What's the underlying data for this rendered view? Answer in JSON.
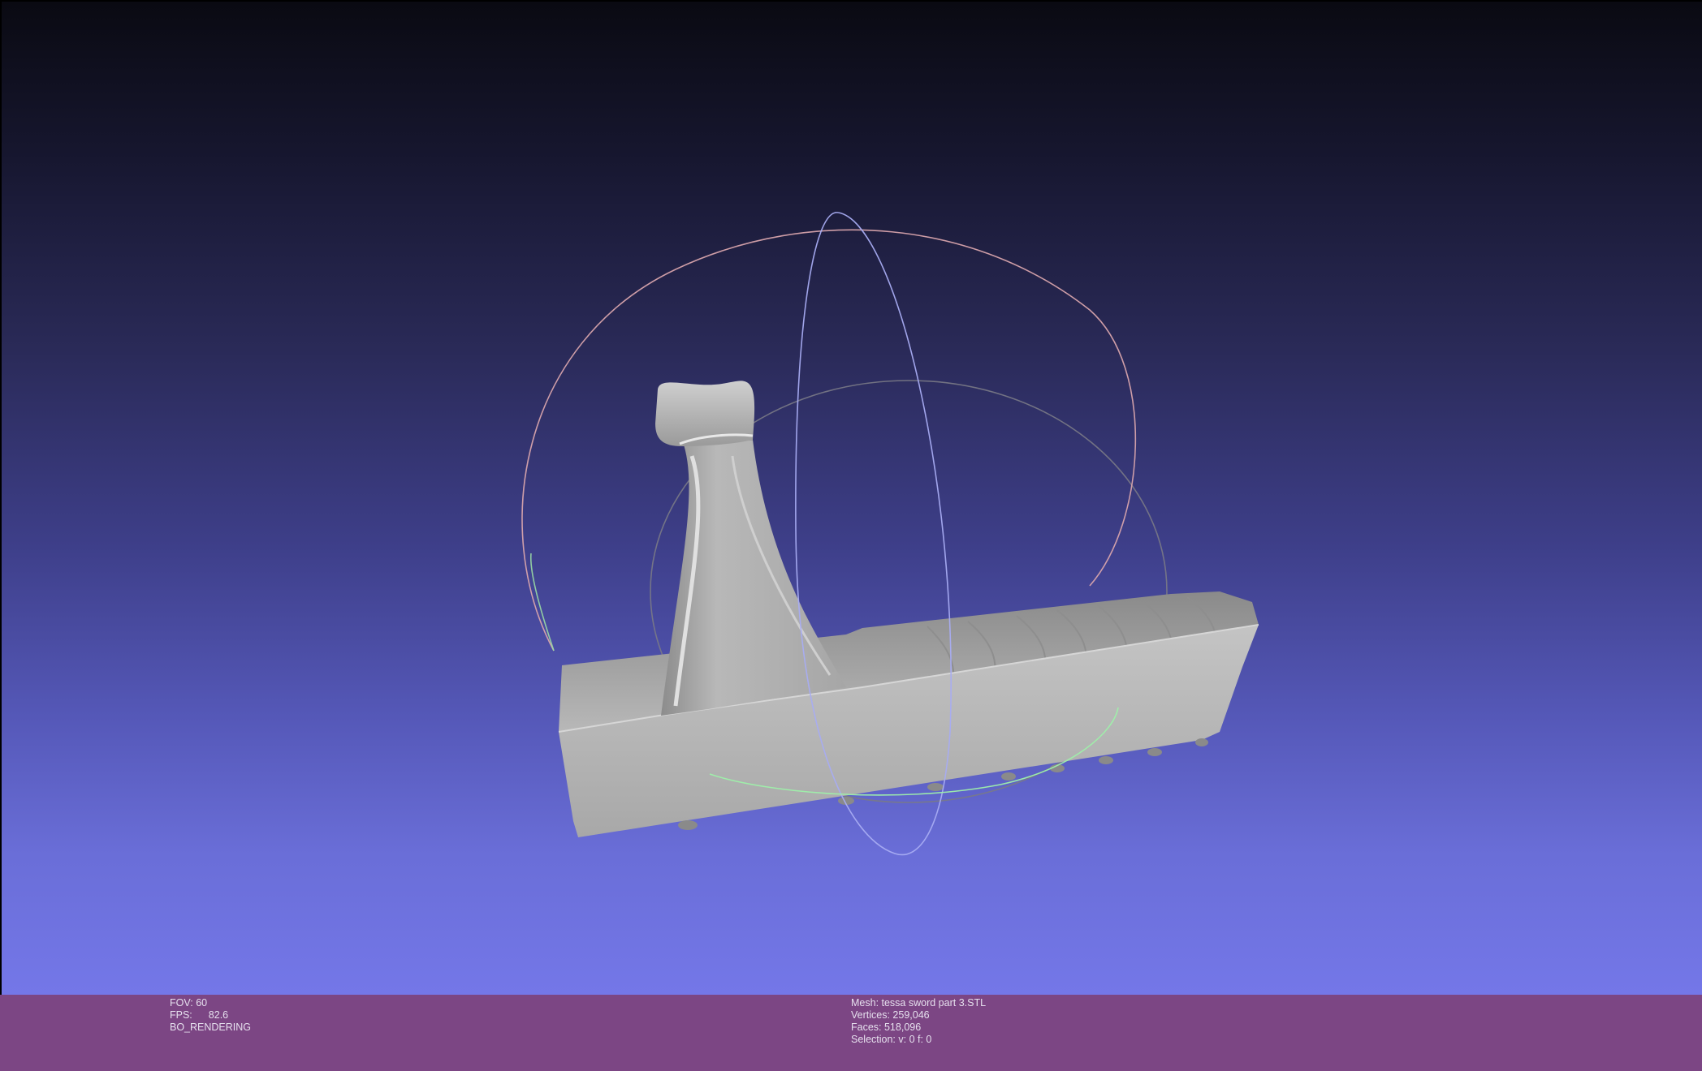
{
  "viewport": {
    "name": "3d-viewport",
    "background_top": "#0a0a12",
    "background_bottom": "#7477e8"
  },
  "trackball": {
    "x_ring_color": "#e0a0a8",
    "y_ring_color": "#a0a8f0",
    "z_ring_color": "#90f0a0"
  },
  "model": {
    "color": "#b4b4b4"
  },
  "info_left": {
    "fov_label": "FOV:",
    "fov_value": "60",
    "fps_label": "FPS:",
    "fps_value": "82.6",
    "mode": "BO_RENDERING"
  },
  "info_right": {
    "mesh": "Mesh: tessa sword part 3.STL",
    "vertices": "Vertices: 259,046",
    "faces": "Faces: 518,096",
    "selection": "Selection: v: 0 f: 0"
  },
  "info_bar_color": "#7c4684"
}
